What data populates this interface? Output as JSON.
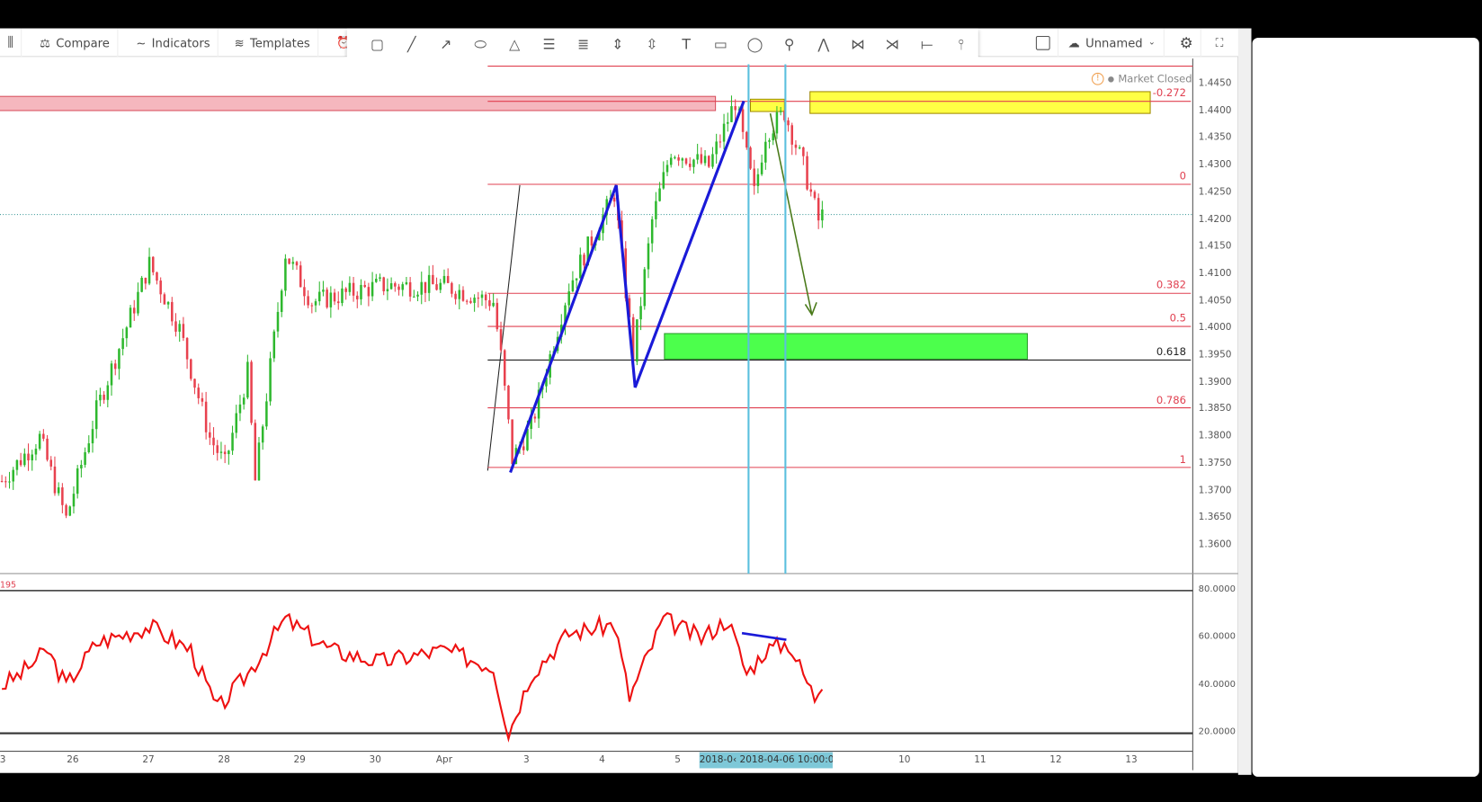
{
  "toolbar": {
    "compare": "Compare",
    "indicators": "Indicators",
    "templates": "Templates",
    "layout_name": "Unnamed"
  },
  "drawing_tools": [
    "rectangle",
    "trend-line",
    "arrow",
    "ellipse",
    "triangle",
    "pitchfork",
    "fib-retracement",
    "fib-channel",
    "fib-time",
    "text",
    "callout",
    "comment",
    "pin",
    "pattern",
    "xabcd",
    "abcd",
    "horizontal-line",
    "vertical-line"
  ],
  "status": {
    "market": "Market Closed"
  },
  "price_axis": [
    "1.4450",
    "1.4400",
    "1.4350",
    "1.4300",
    "1.4250",
    "1.4200",
    "1.4150",
    "1.4100",
    "1.4050",
    "1.4000",
    "1.3950",
    "1.3900",
    "1.3850",
    "1.3800",
    "1.3750",
    "1.3700",
    "1.3650",
    "1.3600"
  ],
  "fib_levels": [
    {
      "label": "-0.272",
      "price": 1.442,
      "color": "#e04050"
    },
    {
      "label": "0",
      "price": 1.4267,
      "color": "#e04050"
    },
    {
      "label": "0.382",
      "price": 1.4066,
      "color": "#e04050"
    },
    {
      "label": "0.5",
      "price": 1.4005,
      "color": "#e04050"
    },
    {
      "label": "0.618",
      "price": 1.3943,
      "color": "#222222"
    },
    {
      "label": "0.786",
      "price": 1.3855,
      "color": "#e04050"
    },
    {
      "label": "1",
      "price": 1.3745,
      "color": "#e04050"
    }
  ],
  "rsi": {
    "label": "195",
    "axis": [
      "80.0000",
      "60.0000",
      "40.0000",
      "20.0000"
    ]
  },
  "time_axis": {
    "labels": [
      "3",
      "26",
      "27",
      "28",
      "29",
      "30",
      "Apr",
      "3",
      "4",
      "5",
      "10",
      "11",
      "12",
      "13"
    ],
    "crosshair": "2018-0‹ 2018-04-06 10:00:00"
  },
  "chart_data": {
    "type": "candlestick",
    "price_anchors": [
      [
        0,
        1.372
      ],
      [
        10,
        1.38
      ],
      [
        17,
        1.365
      ],
      [
        25,
        1.385
      ],
      [
        39,
        1.412
      ],
      [
        47,
        1.4
      ],
      [
        55,
        1.38
      ],
      [
        59,
        1.375
      ],
      [
        65,
        1.392
      ],
      [
        67,
        1.372
      ],
      [
        75,
        1.414
      ],
      [
        82,
        1.405
      ],
      [
        100,
        1.408
      ],
      [
        117,
        1.408
      ],
      [
        130,
        1.405
      ],
      [
        132,
        1.395
      ],
      [
        135,
        1.376
      ],
      [
        140,
        1.382
      ],
      [
        150,
        1.408
      ],
      [
        162,
        1.425
      ],
      [
        167,
        1.395
      ],
      [
        172,
        1.42
      ],
      [
        177,
        1.433
      ],
      [
        187,
        1.43
      ],
      [
        194,
        1.442
      ],
      [
        199,
        1.425
      ],
      [
        202,
        1.436
      ],
      [
        207,
        1.44
      ],
      [
        212,
        1.43
      ],
      [
        216,
        1.42
      ],
      [
        217,
        1.421
      ]
    ],
    "rsi_anchors": [
      [
        0,
        40
      ],
      [
        5,
        45
      ],
      [
        12,
        55
      ],
      [
        17,
        40
      ],
      [
        25,
        58
      ],
      [
        39,
        65
      ],
      [
        50,
        55
      ],
      [
        57,
        30
      ],
      [
        65,
        45
      ],
      [
        75,
        68
      ],
      [
        87,
        55
      ],
      [
        100,
        50
      ],
      [
        117,
        55
      ],
      [
        130,
        48
      ],
      [
        134,
        20
      ],
      [
        140,
        45
      ],
      [
        150,
        62
      ],
      [
        162,
        66
      ],
      [
        166,
        35
      ],
      [
        175,
        68
      ],
      [
        185,
        60
      ],
      [
        192,
        68
      ],
      [
        197,
        45
      ],
      [
        202,
        55
      ],
      [
        208,
        58
      ],
      [
        215,
        35
      ],
      [
        217,
        42
      ]
    ],
    "colors": {
      "up": "#2eb82e",
      "down": "#e8414e",
      "rsi": "#ee1111"
    }
  }
}
